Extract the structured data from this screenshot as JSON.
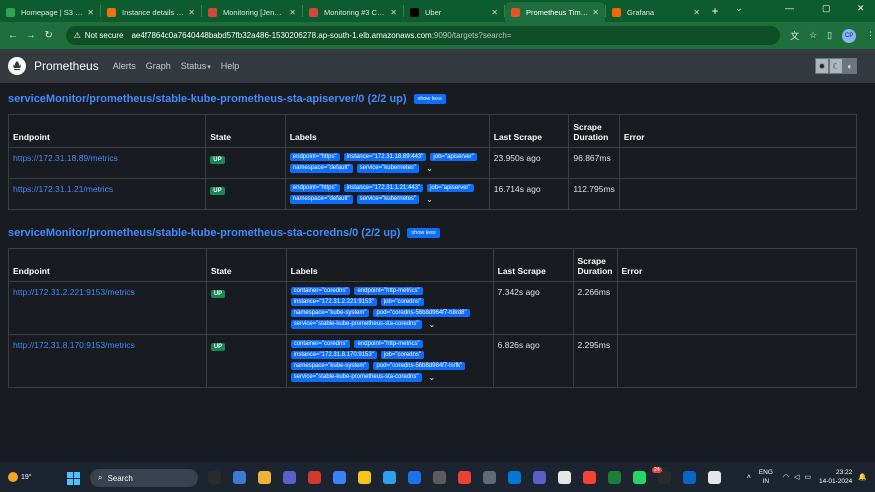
{
  "browser": {
    "tabs": [
      {
        "title": "Homepage | S3 | Glo",
        "fav_color": "#2ea44f"
      },
      {
        "title": "Instance details | EC2",
        "fav_color": "#ec7211"
      },
      {
        "title": "Monitoring [Jenkins]",
        "fav_color": "#d24939"
      },
      {
        "title": "Monitoring #3 Conso",
        "fav_color": "#d24939"
      },
      {
        "title": "Uber",
        "fav_color": "#000000"
      },
      {
        "title": "Prometheus Time Se",
        "fav_color": "#e6522c"
      },
      {
        "title": "Grafana",
        "fav_color": "#f46800"
      }
    ],
    "address": {
      "security": "Not secure",
      "host": "ae4f7864c0a7640448babd57fb32a486-1530206278.ap-south-1.elb.amazonaws.com",
      "path": ":9090/targets?search="
    },
    "profile_initials": "CP"
  },
  "prometheus": {
    "brand": "Prometheus",
    "nav": [
      "Alerts",
      "Graph",
      "Status",
      "Help"
    ],
    "status_caret": "▾"
  },
  "columns": [
    "Endpoint",
    "State",
    "Labels",
    "Last Scrape",
    "Scrape Duration",
    "Error"
  ],
  "pools": [
    {
      "title": "serviceMonitor/prometheus/stable-kube-prometheus-sta-apiserver/0 (2/2 up)",
      "toggle": "show less",
      "targets": [
        {
          "endpoint": "https://172.31.18.89/metrics",
          "state": "UP",
          "labels": [
            "endpoint=\"https\"",
            "instance=\"172.31.18.89:443\"",
            "job=\"apiserver\"",
            "namespace=\"default\"",
            "service=\"kubernetes\""
          ],
          "last_scrape": "23.950s ago",
          "duration": "96.867ms",
          "error": ""
        },
        {
          "endpoint": "https://172.31.1.21/metrics",
          "state": "UP",
          "labels": [
            "endpoint=\"https\"",
            "instance=\"172.31.1.21:443\"",
            "job=\"apiserver\"",
            "namespace=\"default\"",
            "service=\"kubernetes\""
          ],
          "last_scrape": "16.714s ago",
          "duration": "112.795ms",
          "error": ""
        }
      ]
    },
    {
      "title": "serviceMonitor/prometheus/stable-kube-prometheus-sta-coredns/0 (2/2 up)",
      "toggle": "show less",
      "targets": [
        {
          "endpoint": "http://172.31.2.221:9153/metrics",
          "state": "UP",
          "labels": [
            "container=\"coredns\"",
            "endpoint=\"http-metrics\"",
            "instance=\"172.31.2.221:9153\"",
            "job=\"coredns\"",
            "namespace=\"kube-system\"",
            "pod=\"coredns-56b8d964f7-h8rd8\"",
            "service=\"stable-kube-prometheus-sta-coredns\""
          ],
          "last_scrape": "7.342s ago",
          "duration": "2.266ms",
          "error": ""
        },
        {
          "endpoint": "http://172.31.8.170:9153/metrics",
          "state": "UP",
          "labels": [
            "container=\"coredns\"",
            "endpoint=\"http-metrics\"",
            "instance=\"172.31.8.170:9153\"",
            "job=\"coredns\"",
            "namespace=\"kube-system\"",
            "pod=\"coredns-56b8d964f7-lsrfk\"",
            "service=\"stable-kube-prometheus-sta-coredns\""
          ],
          "last_scrape": "6.826s ago",
          "duration": "2.295ms",
          "error": ""
        }
      ]
    }
  ],
  "taskbar": {
    "weather_temp": "19°",
    "search_label": "Search",
    "lang_top": "ENG",
    "lang_bottom": "IN",
    "time": "23:22",
    "date": "14-01-2024",
    "badge_count": "24"
  }
}
